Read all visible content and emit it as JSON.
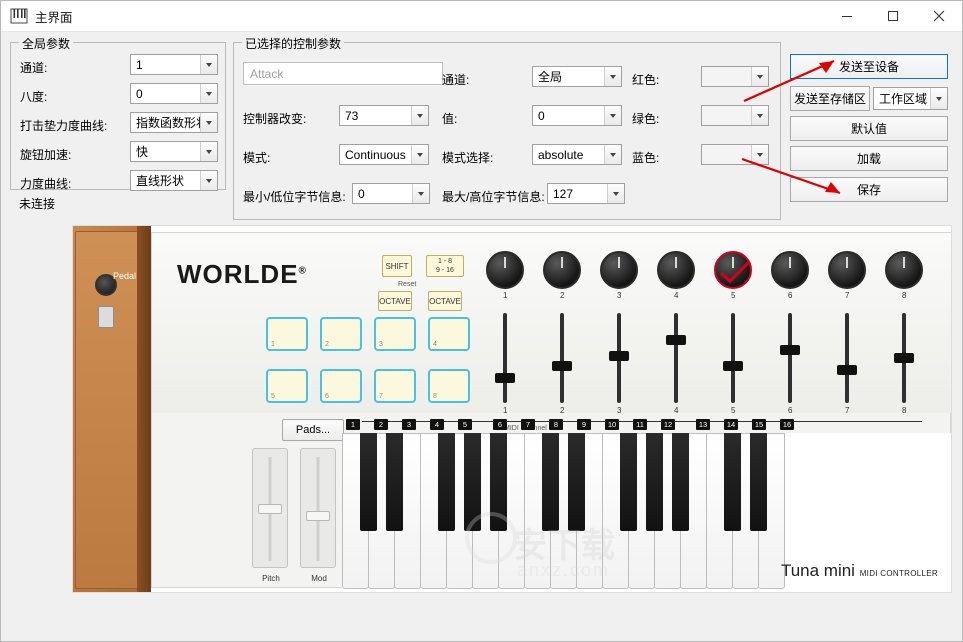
{
  "window": {
    "title": "主界面",
    "icon": "piano-keys-icon",
    "minimize_label": "minimize-icon",
    "maximize_label": "maximize-icon",
    "close_label": "close-icon"
  },
  "global_group": {
    "legend": "全局参数",
    "rows": [
      {
        "label": "通道:",
        "value": "1"
      },
      {
        "label": "八度:",
        "value": "0"
      },
      {
        "label": "打击垫力度曲线:",
        "value": "指数函数形状"
      },
      {
        "label": "旋钮加速:",
        "value": "快"
      },
      {
        "label": "力度曲线:",
        "value": "直线形状"
      }
    ],
    "status": "未连接"
  },
  "selected_group": {
    "legend": "已选择的控制参数",
    "name_placeholder": "Attack",
    "name_value": "",
    "fields": [
      {
        "label": "控制器改变:",
        "value": "73"
      },
      {
        "label": "模式:",
        "value": "Continuous"
      },
      {
        "label": "最小/低位字节信息:",
        "value": "0"
      },
      {
        "label": "通道:",
        "value": "全局"
      },
      {
        "label": "值:",
        "value": "0"
      },
      {
        "label": "模式选择:",
        "value": "absolute"
      },
      {
        "label": "最大/高位字节信息:",
        "value": "127"
      }
    ],
    "colors": [
      {
        "label": "红色:",
        "value": ""
      },
      {
        "label": "绿色:",
        "value": ""
      },
      {
        "label": "蓝色:",
        "value": ""
      }
    ]
  },
  "actions": {
    "send_device": "发送至设备",
    "send_storage": "发送至存储区",
    "workspace": "工作区域",
    "default": "默认值",
    "load": "加载",
    "save": "保存"
  },
  "device": {
    "brand": "WORLDE",
    "brand_reg": "®",
    "model": "Tuna mini",
    "model_sub": "MIDI CONTROLLER",
    "shift_button": "SHIFT",
    "octave_down": "OCTAVE",
    "octave_up": "OCTAVE",
    "bank_label": "1 - 8\n9 - 16",
    "reset_label": "Reset",
    "pedal_label": "Pedal",
    "pads_button": "Pads...",
    "midi_channel_label": "MIDI Channel",
    "knob_numbers": [
      "1",
      "2",
      "3",
      "4",
      "5",
      "6",
      "7",
      "8"
    ],
    "pad_numbers": [
      "1",
      "2",
      "3",
      "4",
      "5",
      "6",
      "7",
      "8"
    ],
    "slider_numbers": [
      "1",
      "2",
      "3",
      "4",
      "5",
      "6",
      "7",
      "8"
    ],
    "key_numbers": [
      "1",
      "2",
      "3",
      "4",
      "5",
      "6",
      "7",
      "8",
      "9",
      "10",
      "11",
      "12",
      "13",
      "14",
      "15",
      "16"
    ],
    "pitch_label": "Pitch",
    "mod_label": "Mod",
    "active_knob_index": 5,
    "watermark_text": "安下载",
    "watermark_sub": "anxz.com"
  },
  "colors": {
    "accent": "#0078d7",
    "arrow": "#e00000",
    "knob_active": "#d0021b",
    "pad_border": "#46c3e0"
  }
}
